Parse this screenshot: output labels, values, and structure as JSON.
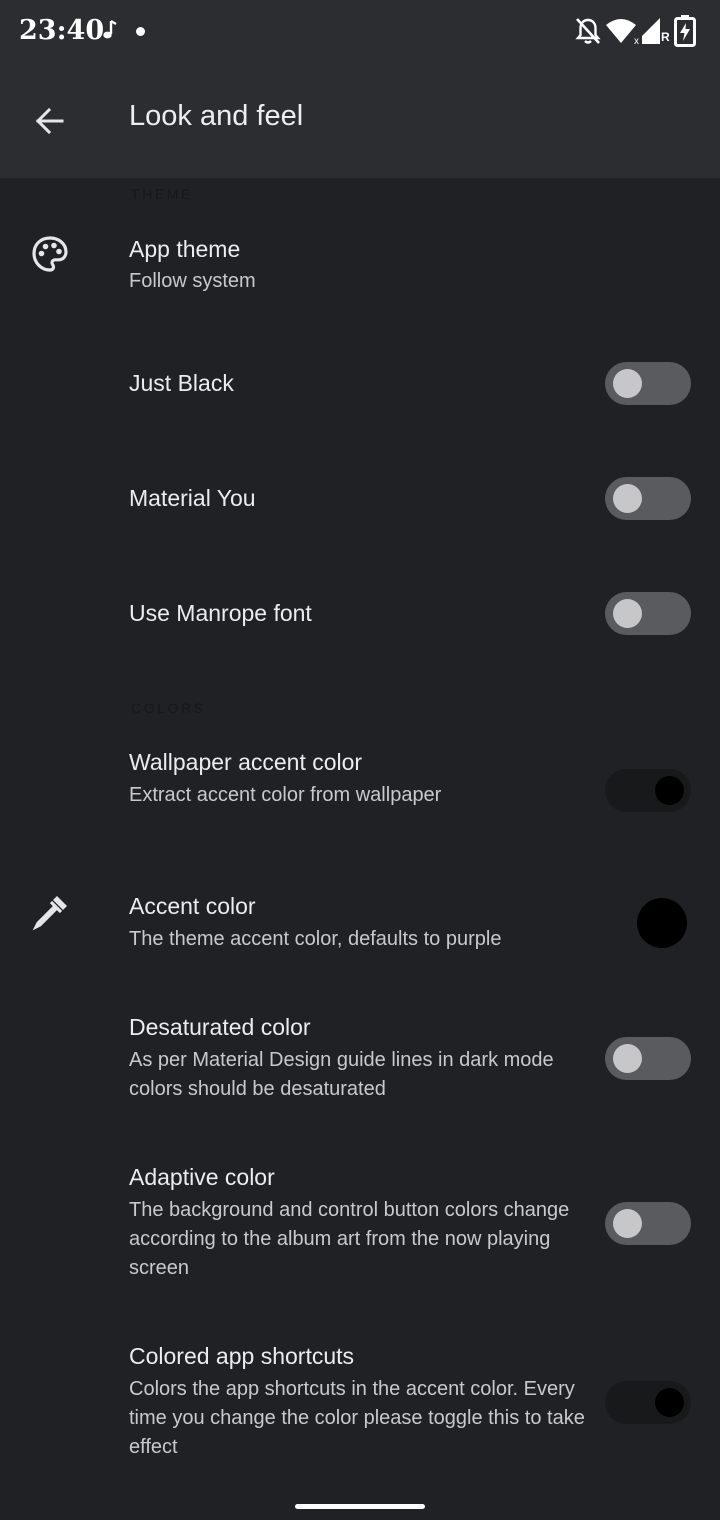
{
  "status_bar": {
    "time": "23:40",
    "icons": [
      "music-note-icon",
      "notification-dot-icon",
      "notifications-off-icon",
      "wifi-icon",
      "cell-signal-icon",
      "battery-charging-icon"
    ],
    "roaming_label": "R"
  },
  "app_bar": {
    "back_icon": "arrow-back-icon",
    "title": "Look and feel"
  },
  "sections": {
    "theme": "THEME",
    "colors": "COLORS"
  },
  "items": {
    "app_theme": {
      "title": "App theme",
      "summary": "Follow system",
      "icon": "palette-icon"
    },
    "just_black": {
      "title": "Just Black",
      "checked": false
    },
    "material_you": {
      "title": "Material You",
      "checked": false
    },
    "manrope_font": {
      "title": "Use Manrope font",
      "checked": false
    },
    "wallpaper_accent": {
      "title": "Wallpaper accent color",
      "summary": "Extract accent color from wallpaper",
      "checked": true
    },
    "accent_color": {
      "title": "Accent color",
      "summary": "The theme accent color, defaults to purple",
      "icon": "eyedropper-icon",
      "swatch_color": "#000000"
    },
    "desaturated": {
      "title": "Desaturated color",
      "summary": "As per Material Design guide lines in dark mode colors should be desaturated",
      "checked": false
    },
    "adaptive": {
      "title": "Adaptive color",
      "summary": "The background and control button colors change according to the album art from the now playing screen",
      "checked": false
    },
    "colored_shortcuts": {
      "title": "Colored app shortcuts",
      "summary": "Colors the app shortcuts in the accent color. Every time you change the color please toggle this to take effect",
      "checked": true
    }
  },
  "colors": {
    "background": "#202125",
    "app_bar": "#2c2d31",
    "switch_off_track": "#5a5b5f",
    "switch_on_track": "#18191b"
  }
}
